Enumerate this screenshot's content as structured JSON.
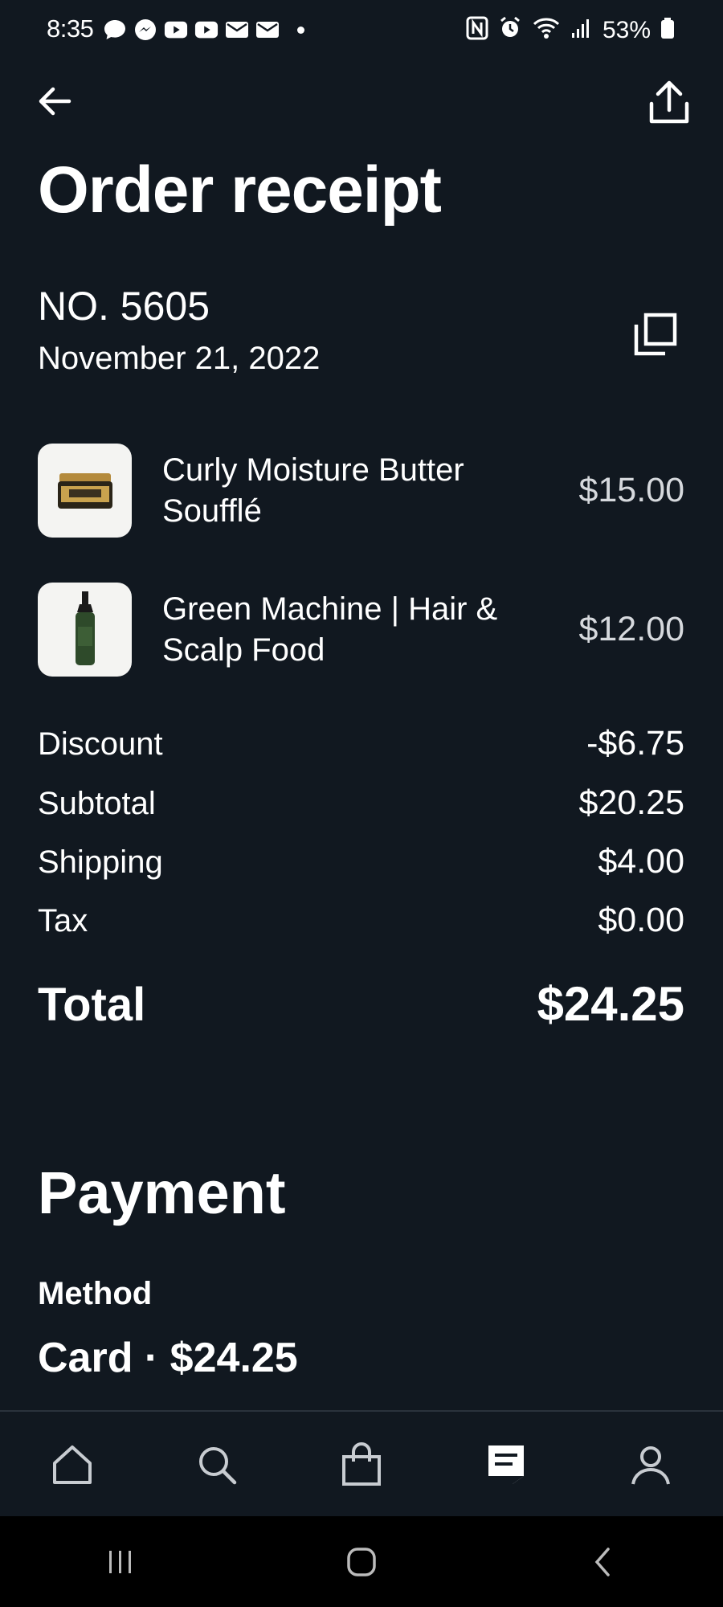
{
  "status_bar": {
    "time": "8:35",
    "battery": "53%",
    "left_icons": [
      "chat-icon",
      "messenger-icon",
      "youtube-icon",
      "youtube-icon",
      "mail-icon",
      "mail-icon"
    ],
    "right_icons": [
      "nfc-icon",
      "alarm-icon",
      "wifi-icon",
      "signal-icon",
      "battery-icon"
    ]
  },
  "header": {
    "back_icon": "arrow-left-icon",
    "share_icon": "share-upload-icon",
    "title": "Order receipt"
  },
  "order": {
    "number": "NO. 5605",
    "date": "November 21, 2022",
    "copy_icon": "copy-icon"
  },
  "items": [
    {
      "name": "Curly Moisture Butter Soufflé",
      "price": "$15.00",
      "thumb": "jar-product-image"
    },
    {
      "name": "Green Machine | Hair & Scalp Food",
      "price": "$12.00",
      "thumb": "bottle-product-image"
    }
  ],
  "summary": [
    {
      "label": "Discount",
      "value": "-$6.75"
    },
    {
      "label": "Subtotal",
      "value": "$20.25"
    },
    {
      "label": "Shipping",
      "value": "$4.00"
    },
    {
      "label": "Tax",
      "value": "$0.00"
    }
  ],
  "total": {
    "label": "Total",
    "value": "$24.25"
  },
  "payment": {
    "title": "Payment",
    "method_label": "Method",
    "method_value": "Card · $24.25"
  },
  "bottom_nav": {
    "items": [
      "home-icon",
      "search-icon",
      "shopping-bag-icon",
      "receipt-icon",
      "profile-icon"
    ],
    "active": "receipt-icon"
  },
  "system_nav": [
    "recents-icon",
    "home-button-icon",
    "back-icon"
  ],
  "colors": {
    "background": "#111820",
    "text": "#ffffff",
    "muted_price": "#d6d9dd",
    "system_bar": "#000000"
  }
}
